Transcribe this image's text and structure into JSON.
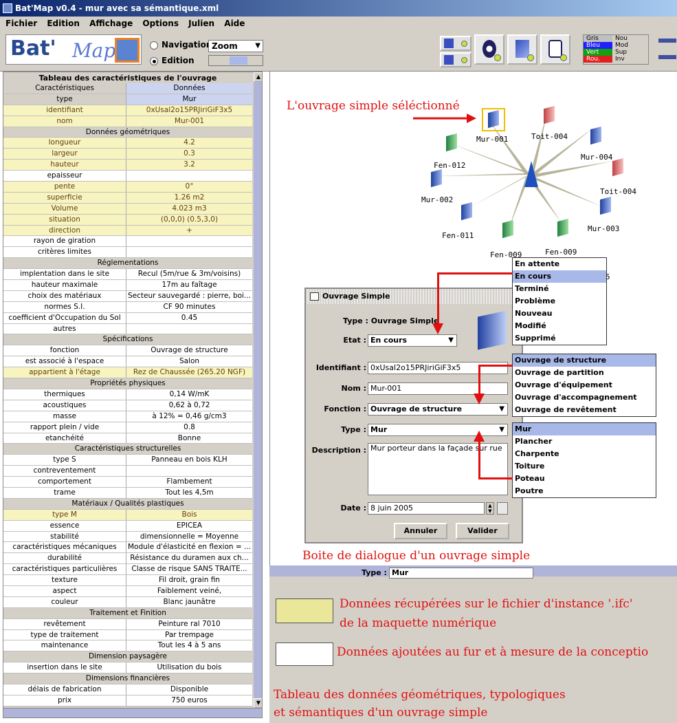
{
  "window": {
    "title": "Bat'Map v0.4 - mur avec sa sémantique.xml"
  },
  "menu": [
    "Fichier",
    "Edition",
    "Affichage",
    "Options",
    "Julien",
    "Aide"
  ],
  "toolbar": {
    "logo_bat": "Bat'",
    "logo_map": "Map.",
    "mode_navigation": "Navigation",
    "mode_edition": "Edition",
    "zoom_label": "Zoom",
    "legend": [
      [
        "Gris",
        "Nou"
      ],
      [
        "Bleu",
        "Mod"
      ],
      [
        "Vert",
        "Sup"
      ],
      [
        "Rou.",
        "Inv"
      ]
    ],
    "legend_colors": [
      "#c0c0c0",
      "#2020ff",
      "#10a010",
      "#e02020"
    ]
  },
  "table": {
    "title": "Tableau des caractéristiques de l'ouvrage",
    "rows": [
      {
        "k": "Caractéristiques",
        "v": "Données",
        "t": "hd"
      },
      {
        "k": "type",
        "v": "Mur",
        "t": "hd"
      },
      {
        "k": "identifiant",
        "v": "0xUsal2o15PRJiriGiF3x5",
        "t": "y"
      },
      {
        "k": "nom",
        "v": "Mur-001",
        "t": "y"
      },
      {
        "k": "Données géométriques",
        "v": "",
        "t": "sec"
      },
      {
        "k": "longueur",
        "v": "4.2",
        "t": "y"
      },
      {
        "k": "largeur",
        "v": "0.3",
        "t": "y"
      },
      {
        "k": "hauteur",
        "v": "3.2",
        "t": "y"
      },
      {
        "k": "epaisseur",
        "v": "",
        "t": "w"
      },
      {
        "k": "pente",
        "v": "0°",
        "t": "y"
      },
      {
        "k": "superficie",
        "v": "1.26 m2",
        "t": "y"
      },
      {
        "k": "Volume",
        "v": "4.023 m3",
        "t": "y"
      },
      {
        "k": "situation",
        "v": "(0,0,0) (0.5,3,0)",
        "t": "y"
      },
      {
        "k": "direction",
        "v": "+",
        "t": "y"
      },
      {
        "k": "rayon de giration",
        "v": "",
        "t": "w"
      },
      {
        "k": "critères limites",
        "v": "",
        "t": "w"
      },
      {
        "k": "Réglementations",
        "v": "",
        "t": "sec"
      },
      {
        "k": "implentation dans le site",
        "v": "Recul (5m/rue & 3m/voisins)",
        "t": "w"
      },
      {
        "k": "hauteur maximale",
        "v": "17m au faîtage",
        "t": "w"
      },
      {
        "k": "choix des matériaux",
        "v": "Secteur sauvegardé : pierre, boi...",
        "t": "w"
      },
      {
        "k": "normes S.I.",
        "v": "CF 90 minutes",
        "t": "w"
      },
      {
        "k": "coefficient d'Occupation du Sol",
        "v": "0.45",
        "t": "w"
      },
      {
        "k": "autres",
        "v": "",
        "t": "w"
      },
      {
        "k": "Spécifications",
        "v": "",
        "t": "sec"
      },
      {
        "k": "fonction",
        "v": "Ouvrage de structure",
        "t": "w"
      },
      {
        "k": "est associé à l'espace",
        "v": "Salon",
        "t": "w"
      },
      {
        "k": "appartient à l'étage",
        "v": "Rez de Chaussée (265.20 NGF)",
        "t": "y"
      },
      {
        "k": "Propriétés physiques",
        "v": "",
        "t": "sec"
      },
      {
        "k": "thermiques",
        "v": "0,14 W/mK",
        "t": "w"
      },
      {
        "k": "acoustiques",
        "v": "0,62 à 0,72",
        "t": "w"
      },
      {
        "k": "masse",
        "v": "à 12% =  0,46 g/cm3",
        "t": "w"
      },
      {
        "k": "rapport plein / vide",
        "v": "0.8",
        "t": "w"
      },
      {
        "k": "etanchéité",
        "v": "Bonne",
        "t": "w"
      },
      {
        "k": "Caractéristiques structurelles",
        "v": "",
        "t": "sec"
      },
      {
        "k": "type S",
        "v": "Panneau en bois KLH",
        "t": "w"
      },
      {
        "k": "contreventement",
        "v": "",
        "t": "w"
      },
      {
        "k": "comportement",
        "v": "Flambement",
        "t": "w"
      },
      {
        "k": "trame",
        "v": "Tout les 4,5m",
        "t": "w"
      },
      {
        "k": "Matériaux / Qualités plastiques",
        "v": "",
        "t": "sec"
      },
      {
        "k": "type M",
        "v": "Bois",
        "t": "y"
      },
      {
        "k": "essence",
        "v": "EPICEA",
        "t": "w"
      },
      {
        "k": "stabilité",
        "v": "dimensionnelle =  Moyenne",
        "t": "w"
      },
      {
        "k": "caractéristiques mécaniques",
        "v": "Module d'élasticité en flexion = ...",
        "t": "w"
      },
      {
        "k": "durabilité",
        "v": "Résistance du duramen aux ch...",
        "t": "w"
      },
      {
        "k": "caractéristiques particulières",
        "v": "Classe de risque SANS TRAITE...",
        "t": "w"
      },
      {
        "k": "texture",
        "v": "Fil droit, grain fin",
        "t": "w"
      },
      {
        "k": "aspect",
        "v": "Faiblement veiné,",
        "t": "w"
      },
      {
        "k": "couleur",
        "v": "Blanc jaunâtre",
        "t": "w"
      },
      {
        "k": "Traitement et Finition",
        "v": "",
        "t": "sec"
      },
      {
        "k": "revêtement",
        "v": "Peinture ral 7010",
        "t": "w"
      },
      {
        "k": "type de traitement",
        "v": "Par trempage",
        "t": "w"
      },
      {
        "k": "maintenance",
        "v": "Tout les 4 à 5 ans",
        "t": "w"
      },
      {
        "k": "Dimension paysagère",
        "v": "",
        "t": "sec"
      },
      {
        "k": "insertion dans le site",
        "v": "Utilisation du bois",
        "t": "w"
      },
      {
        "k": "Dimensions financières",
        "v": "",
        "t": "sec"
      },
      {
        "k": "délais de fabrication",
        "v": "Disponible",
        "t": "w"
      },
      {
        "k": "prix",
        "v": "750 euros",
        "t": "w"
      }
    ]
  },
  "graph": {
    "annotation_selected": "L'ouvrage simple séléctionné",
    "nodes": [
      "Mur-001",
      "Toit-004",
      "Mur-004",
      "Toit-004",
      "Mur-003",
      "Fen-009",
      "Fen-009",
      "Fen-011",
      "Mur-002",
      "Fen-012"
    ]
  },
  "dialog": {
    "title": "Ouvrage Simple",
    "type_line": "Type : Ouvrage Simple",
    "etat_label": "Etat :",
    "etat_value": "En cours",
    "id_label": "Identifiant :",
    "id_value": "0xUsal2o15PRJiriGiF3x5",
    "nom_label": "Nom :",
    "nom_value": "Mur-001",
    "fonction_label": "Fonction :",
    "fonction_value": "Ouvrage de structure",
    "type_label": "Type :",
    "type_value": "Mur",
    "desc_label": "Description :",
    "desc_value": "Mur porteur dans la façade sur rue",
    "date_label": "Date :",
    "date_value": "8 juin 2005",
    "cancel": "Annuler",
    "ok": "Valider",
    "caption": "Boite de dialogue d'un ouvrage simple"
  },
  "popup_etat": [
    "En attente",
    "En cours",
    "Terminé",
    "Problème",
    "Nouveau",
    "Modifié",
    "Supprimé"
  ],
  "popup_fonction": [
    "Ouvrage de structure",
    "Ouvrage de partition",
    "Ouvrage d'équipement",
    "Ouvrage d'accompagnement",
    "Ouvrage de revêtement"
  ],
  "popup_type": [
    "Mur",
    "Plancher",
    "Charpente",
    "Toiture",
    "Poteau",
    "Poutre"
  ],
  "bottom": {
    "type_label": "Type :",
    "type_value": "Mur",
    "legend_yellow_1": "Données récupérées sur le fichier d'instance '.ifc'",
    "legend_yellow_2": "de la maquette numérique",
    "legend_white": "Données ajoutées au fur et à mesure de la conceptio",
    "footer_1": "Tableau des données géométriques, typologiques",
    "footer_2": "et sémantiques d'un ouvrage simple",
    "partial_number": "5"
  }
}
